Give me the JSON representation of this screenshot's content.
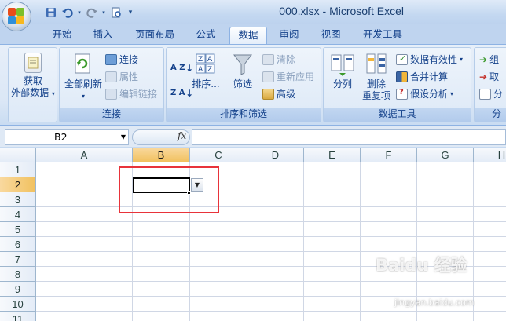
{
  "window": {
    "title": "000.xlsx - Microsoft Excel"
  },
  "quick_access": [
    "save-icon",
    "undo-icon",
    "redo-icon",
    "print-preview-icon",
    "customize-qat-icon"
  ],
  "tabs": [
    {
      "label": "开始",
      "active": false
    },
    {
      "label": "插入",
      "active": false
    },
    {
      "label": "页面布局",
      "active": false
    },
    {
      "label": "公式",
      "active": false
    },
    {
      "label": "数据",
      "active": true
    },
    {
      "label": "审阅",
      "active": false
    },
    {
      "label": "视图",
      "active": false
    },
    {
      "label": "开发工具",
      "active": false
    }
  ],
  "ribbon": {
    "external": {
      "label_line1": "获取",
      "label_line2": "外部数据"
    },
    "connections": {
      "group_label": "连接",
      "refresh_all": "全部刷新",
      "connections": "连接",
      "properties": "属性",
      "edit_links": "编辑链接"
    },
    "sort_filter": {
      "group_label": "排序和筛选",
      "sort": "排序...",
      "filter": "筛选",
      "clear": "清除",
      "reapply": "重新应用",
      "advanced": "高级",
      "az": "A Z",
      "za": "Z A"
    },
    "data_tools": {
      "group_label": "数据工具",
      "text_to_columns": "分列",
      "remove_duplicates_1": "删除",
      "remove_duplicates_2": "重复项",
      "validation": "数据有效性",
      "consolidate": "合并计算",
      "what_if": "假设分析"
    },
    "outline": {
      "group_label": "分",
      "group": "组",
      "ungroup": "取",
      "subtotal": "分"
    }
  },
  "formula_bar": {
    "name_box": "B2",
    "fx": "fx",
    "value": ""
  },
  "grid": {
    "columns": [
      "A",
      "B",
      "C",
      "D",
      "E",
      "F",
      "G",
      "H"
    ],
    "rows": [
      "1",
      "2",
      "3",
      "4",
      "5",
      "6",
      "7",
      "8",
      "9",
      "10",
      "11"
    ],
    "selected_column": "B",
    "selected_row": "2"
  },
  "watermark": {
    "text": "Baidu 经验",
    "sub": "jingyan.baidu.com"
  }
}
